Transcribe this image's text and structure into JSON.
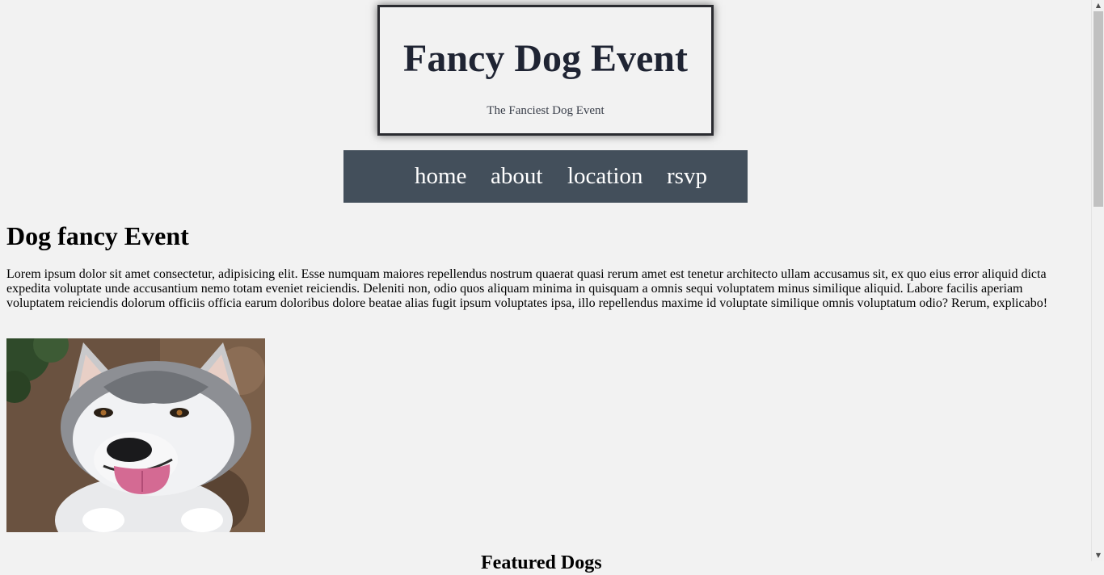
{
  "header": {
    "title": "Fancy Dog Event",
    "subtitle": "The Fanciest Dog Event"
  },
  "nav": {
    "items": [
      {
        "label": "home"
      },
      {
        "label": "about"
      },
      {
        "label": "location"
      },
      {
        "label": "rsvp"
      }
    ]
  },
  "main": {
    "heading": "Dog fancy Event",
    "paragraph": "Lorem ipsum dolor sit amet consectetur, adipisicing elit. Esse numquam maiores repellendus nostrum quaerat quasi rerum amet est tenetur architecto ullam accusamus sit, ex quo eius error aliquid dicta expedita voluptate unde accusantium nemo totam eveniet reiciendis. Deleniti non, odio quos aliquam minima in quisquam a omnis sequi voluptatem minus similique aliquid. Labore facilis aperiam voluptatem reiciendis dolorum officiis officia earum doloribus dolore beatae alias fugit ipsum voluptates ipsa, illo repellendus maxime id voluptate similique omnis voluptatum odio? Rerum, explicabo!",
    "next_heading": "Featured Dogs"
  },
  "colors": {
    "background": "#f2f2f2",
    "nav_background": "#434f5b",
    "title_color": "#1f2433"
  },
  "icons": {
    "scroll_up": "scroll-up-arrow-icon",
    "scroll_down": "scroll-down-arrow-icon"
  }
}
